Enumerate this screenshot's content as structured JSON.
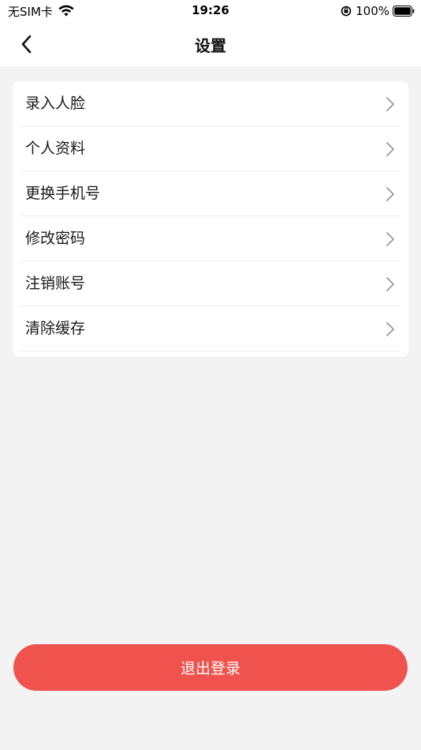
{
  "status_bar": {
    "carrier": "无SIM卡",
    "time": "19:26",
    "battery": "100%"
  },
  "nav": {
    "title": "设置"
  },
  "menu": {
    "items": [
      {
        "label": "录入人脸"
      },
      {
        "label": "个人资料"
      },
      {
        "label": "更换手机号"
      },
      {
        "label": "修改密码"
      },
      {
        "label": "注销账号"
      },
      {
        "label": "清除缓存"
      }
    ]
  },
  "logout": {
    "label": "退出登录"
  },
  "colors": {
    "accent": "#f0534d",
    "background": "#f3f3f4"
  }
}
